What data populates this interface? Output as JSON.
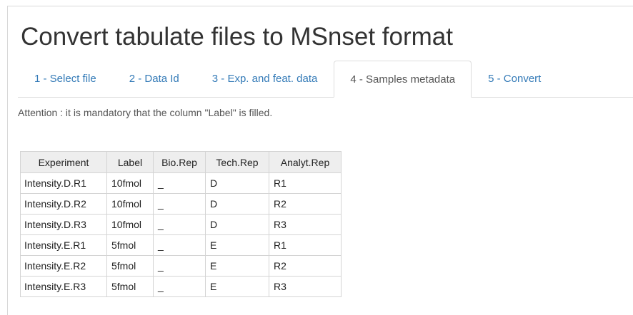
{
  "page": {
    "title": "Convert tabulate files to MSnset format",
    "notice": "Attention : it is mandatory that the column \"Label\" is filled."
  },
  "tabs": [
    {
      "label": "1 - Select file",
      "active": false
    },
    {
      "label": "2 - Data Id",
      "active": false
    },
    {
      "label": "3 - Exp. and feat. data",
      "active": false
    },
    {
      "label": "4 - Samples metadata",
      "active": true
    },
    {
      "label": "5 - Convert",
      "active": false
    }
  ],
  "table": {
    "headers": [
      "Experiment",
      "Label",
      "Bio.Rep",
      "Tech.Rep",
      "Analyt.Rep"
    ],
    "rows": [
      [
        "Intensity.D.R1",
        "10fmol",
        "_",
        "D",
        "R1"
      ],
      [
        "Intensity.D.R2",
        "10fmol",
        "_",
        "D",
        "R2"
      ],
      [
        "Intensity.D.R3",
        "10fmol",
        "_",
        "D",
        "R3"
      ],
      [
        "Intensity.E.R1",
        "5fmol",
        "_",
        "E",
        "R1"
      ],
      [
        "Intensity.E.R2",
        "5fmol",
        "_",
        "E",
        "R2"
      ],
      [
        "Intensity.E.R3",
        "5fmol",
        "_",
        "E",
        "R3"
      ]
    ]
  },
  "colors": {
    "link": "#337ab7",
    "active_tab_text": "#555555",
    "header_bg": "#eeeeee",
    "border": "#dddddd"
  }
}
